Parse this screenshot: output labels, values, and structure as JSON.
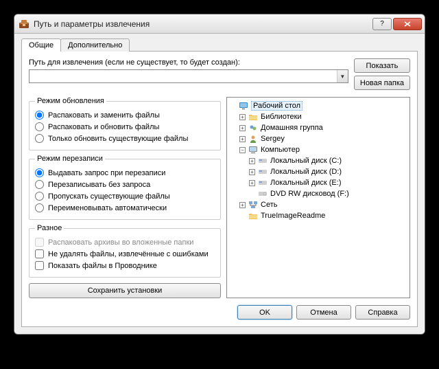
{
  "title": "Путь и параметры извлечения",
  "tabs": {
    "general": "Общие",
    "advanced": "Дополнительно"
  },
  "path": {
    "label": "Путь для извлечения (если не существует, то будет создан):",
    "value": ""
  },
  "buttons": {
    "show": "Показать",
    "newfolder": "Новая папка",
    "save_settings": "Сохранить установки",
    "ok": "OK",
    "cancel": "Отмена",
    "help": "Справка"
  },
  "update_mode": {
    "legend": "Режим обновления",
    "opt1": "Распаковать и заменить файлы",
    "opt2": "Распаковать и обновить файлы",
    "opt3": "Только обновить существующие файлы"
  },
  "overwrite_mode": {
    "legend": "Режим перезаписи",
    "opt1": "Выдавать запрос при перезаписи",
    "opt2": "Перезаписывать без запроса",
    "opt3": "Пропускать существующие файлы",
    "opt4": "Переименовывать автоматически"
  },
  "misc": {
    "legend": "Разное",
    "opt1": "Распаковать архивы во вложенные папки",
    "opt2": "Не удалять файлы, извлечённые с ошибками",
    "opt3": "Показать файлы в Проводнике"
  },
  "tree": {
    "desktop": "Рабочий стол",
    "libraries": "Библиотеки",
    "homegroup": "Домашняя группа",
    "user": "Sergey",
    "computer": "Компьютер",
    "drive_c": "Локальный диск (C:)",
    "drive_d": "Локальный диск (D:)",
    "drive_e": "Локальный диск (E:)",
    "drive_f": "DVD RW дисковод (F:)",
    "network": "Сеть",
    "readme": "TrueImageReadme"
  }
}
